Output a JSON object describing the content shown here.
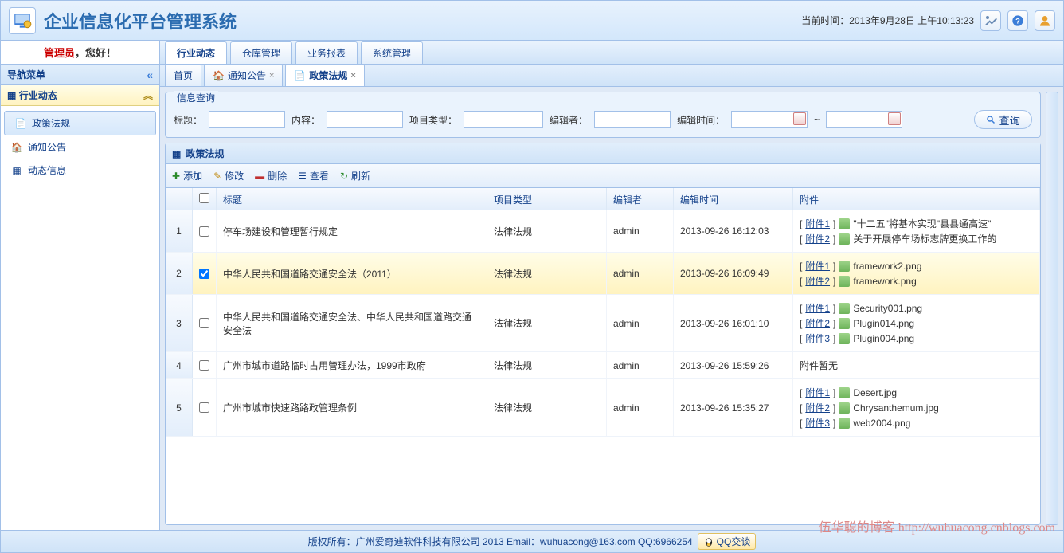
{
  "header": {
    "app_title": "企业信息化平台管理系统",
    "time_label": "当前时间：",
    "time_value": "2013年9月28日 上午10:13:23"
  },
  "greeting": {
    "admin": "管理员",
    "suffix": "，您好！"
  },
  "main_tabs": [
    "行业动态",
    "仓库管理",
    "业务报表",
    "系统管理"
  ],
  "sidebar": {
    "title": "导航菜单",
    "accordion_title": "行业动态",
    "items": [
      {
        "label": "政策法规",
        "selected": true
      },
      {
        "label": "通知公告",
        "selected": false
      },
      {
        "label": "动态信息",
        "selected": false
      }
    ]
  },
  "inner_tabs": [
    {
      "label": "首页",
      "closable": false,
      "active": false
    },
    {
      "label": "通知公告",
      "closable": true,
      "active": false
    },
    {
      "label": "政策法规",
      "closable": true,
      "active": true
    }
  ],
  "search": {
    "legend": "信息查询",
    "title_label": "标题：",
    "content_label": "内容：",
    "type_label": "项目类型：",
    "editor_label": "编辑者：",
    "time_label": "编辑时间：",
    "range_sep": "~",
    "query_btn": "查询"
  },
  "grid": {
    "panel_title": "政策法规",
    "toolbar": {
      "add": "添加",
      "edit": "修改",
      "del": "删除",
      "view": "查看",
      "refresh": "刷新"
    },
    "headers": {
      "title": "标题",
      "type": "项目类型",
      "editor": "编辑者",
      "time": "编辑时间",
      "att": "附件"
    },
    "att_prefix": "附件",
    "no_att": "附件暂无",
    "rows": [
      {
        "num": "1",
        "checked": false,
        "title": "停车场建设和管理暂行规定",
        "type": "法律法规",
        "editor": "admin",
        "time": "2013-09-26 16:12:03",
        "atts": [
          "\"十二五\"将基本实现\"县县通高速\"",
          "关于开展停车场标志牌更换工作的"
        ]
      },
      {
        "num": "2",
        "checked": true,
        "selected": true,
        "title": "中华人民共和国道路交通安全法（2011）",
        "type": "法律法规",
        "editor": "admin",
        "time": "2013-09-26 16:09:49",
        "atts": [
          "framework2.png",
          "framework.png"
        ]
      },
      {
        "num": "3",
        "checked": false,
        "title": "中华人民共和国道路交通安全法、中华人民共和国道路交通安全法",
        "type": "法律法规",
        "editor": "admin",
        "time": "2013-09-26 16:01:10",
        "atts": [
          "Security001.png",
          "Plugin014.png",
          "Plugin004.png"
        ]
      },
      {
        "num": "4",
        "checked": false,
        "title": "广州市城市道路临时占用管理办法，1999市政府",
        "type": "法律法规",
        "editor": "admin",
        "time": "2013-09-26 15:59:26",
        "atts": []
      },
      {
        "num": "5",
        "checked": false,
        "title": "广州市城市快速路路政管理条例",
        "type": "法律法规",
        "editor": "admin",
        "time": "2013-09-26 15:35:27",
        "atts": [
          "Desert.jpg",
          "Chrysanthemum.jpg",
          "web2004.png"
        ]
      }
    ]
  },
  "footer": {
    "copyright": "版权所有：广州爱奇迪软件科技有限公司 2013 Email：wuhuacong@163.com QQ:6966254",
    "qq_btn": "QQ交谈",
    "watermark": "伍华聪的博客 http://wuhuacong.cnblogs.com"
  }
}
